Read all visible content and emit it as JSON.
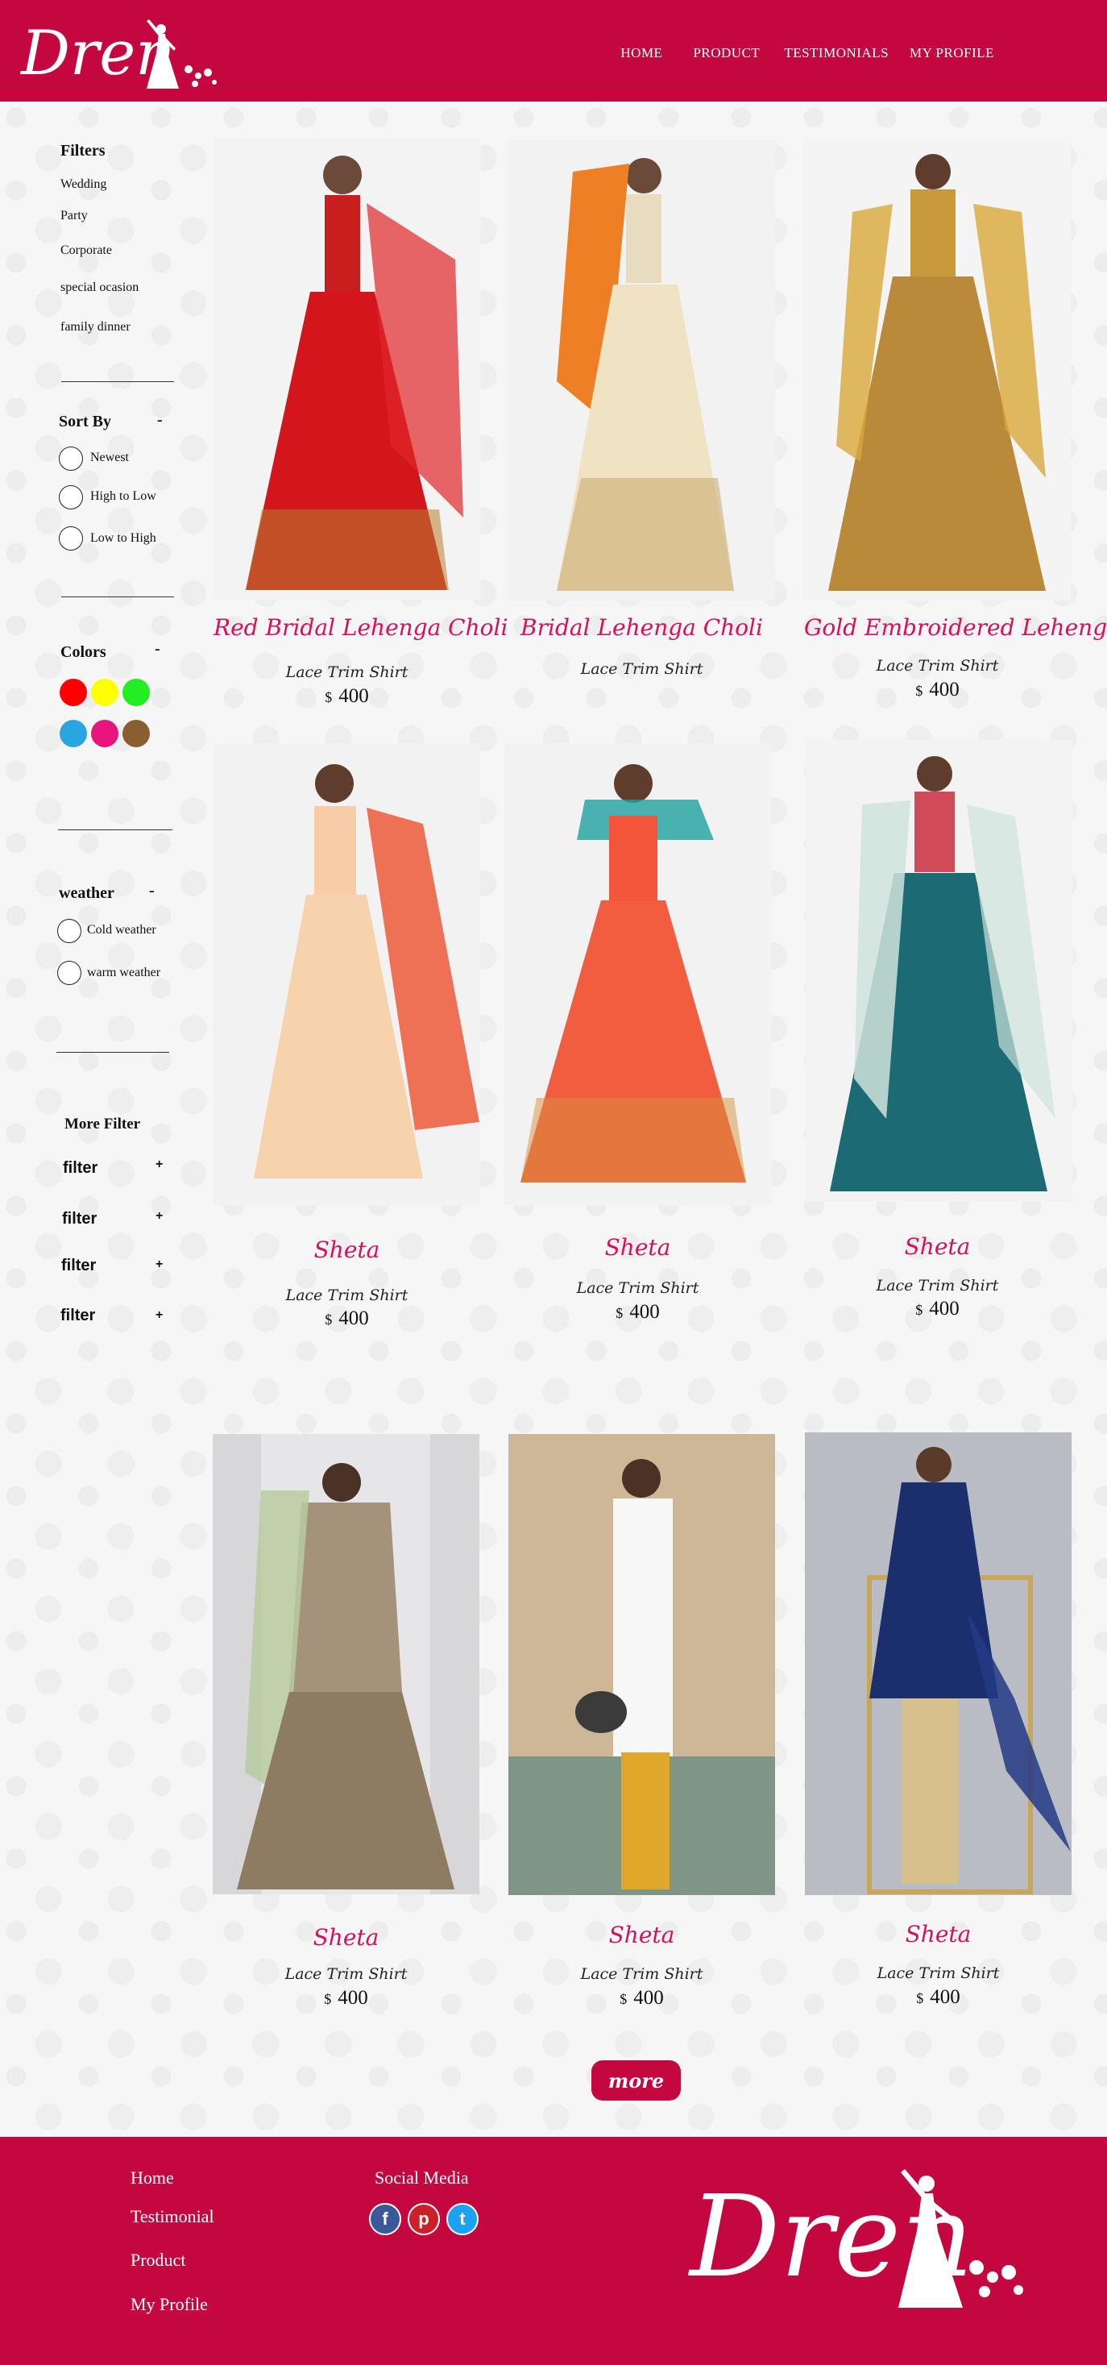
{
  "header": {
    "logo_text": "Dren",
    "nav": [
      "HOME",
      "PRODUCT",
      "TESTIMONIALS",
      "MY PROFILE"
    ]
  },
  "sidebar": {
    "filters_title": "Filters",
    "filters": [
      "Wedding",
      "Party",
      "Corporate",
      "special ocasion",
      "family dinner"
    ],
    "sort_title": "Sort By",
    "sort_toggle": "-",
    "sort_options": [
      "Newest",
      "High to Low",
      "Low to High"
    ],
    "colors_title": "Colors",
    "colors_toggle": "-",
    "colors": [
      "#ff0000",
      "#ffff00",
      "#22ee22",
      "#29a6e0",
      "#e8157e",
      "#8a5e30"
    ],
    "weather_title": "weather",
    "weather_toggle": "-",
    "weather_options": [
      "Cold  weather",
      "warm weather"
    ],
    "more_filter_title": "More Filter",
    "more_filters": [
      {
        "label": "filter",
        "icon": "+"
      },
      {
        "label": "filter",
        "icon": "+"
      },
      {
        "label": "filter",
        "icon": "+"
      },
      {
        "label": "filter",
        "icon": "+"
      }
    ]
  },
  "products": [
    {
      "name": "Red Bridal Lehenga Choli",
      "sub": "Lace Trim Shirt",
      "currency": "$",
      "price": "400"
    },
    {
      "name": "Bridal Lehenga Choli",
      "sub": "Lace Trim Shirt",
      "currency": "",
      "price": ""
    },
    {
      "name": "Gold Embroidered Lehenga",
      "sub": "Lace Trim Shirt",
      "currency": "$",
      "price": "400"
    },
    {
      "name": "Sheta",
      "sub": "Lace Trim Shirt",
      "currency": "$",
      "price": "400"
    },
    {
      "name": "Sheta",
      "sub": "Lace Trim Shirt",
      "currency": "$",
      "price": "400"
    },
    {
      "name": "Sheta",
      "sub": "Lace Trim Shirt",
      "currency": "$",
      "price": "400"
    },
    {
      "name": "Sheta",
      "sub": "Lace Trim Shirt",
      "currency": "$",
      "price": "400"
    },
    {
      "name": "Sheta",
      "sub": "Lace Trim Shirt",
      "currency": "$",
      "price": "400"
    },
    {
      "name": "Sheta",
      "sub": "Lace Trim Shirt",
      "currency": "$",
      "price": "400"
    }
  ],
  "more_button": "more",
  "footer": {
    "links": [
      "Home",
      "Testimonial",
      "Product",
      "My Profile"
    ],
    "social_title": "Social Media",
    "social": [
      {
        "icon": "facebook-icon",
        "glyph": "f",
        "color": "#3b5998"
      },
      {
        "icon": "pinterest-icon",
        "glyph": "p",
        "color": "#cb2027"
      },
      {
        "icon": "twitter-icon",
        "glyph": "t",
        "color": "#1da1f2"
      }
    ],
    "logo_text": "Dren"
  }
}
